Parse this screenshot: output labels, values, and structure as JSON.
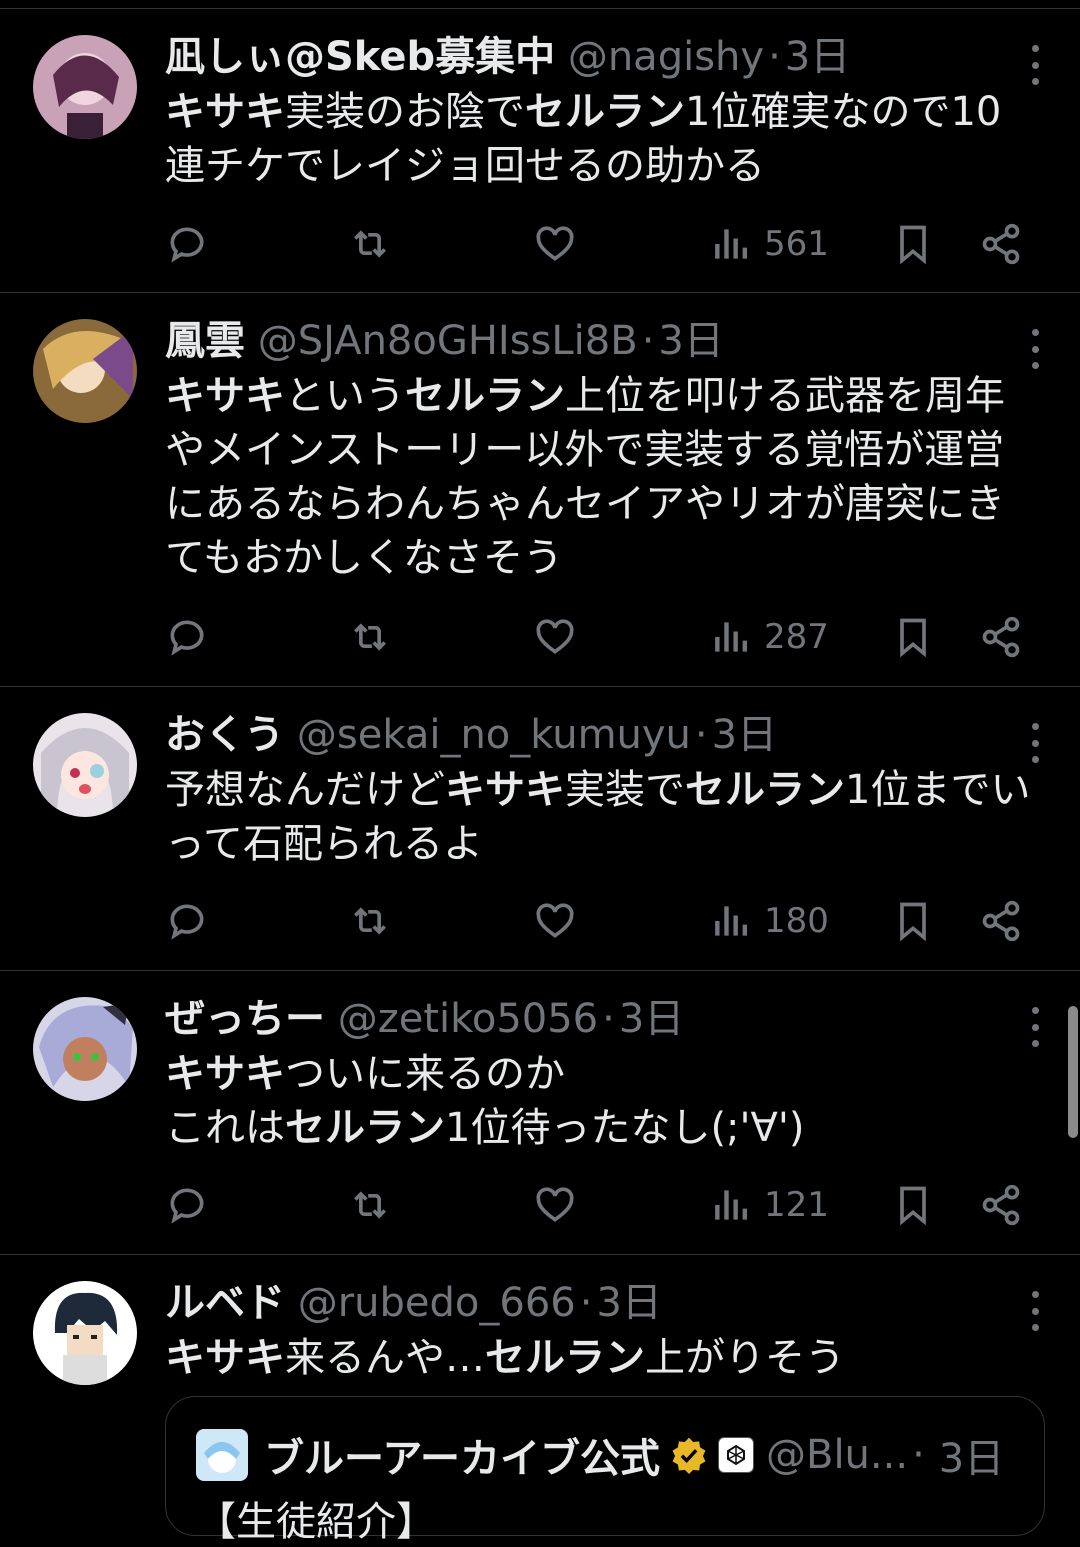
{
  "tweets": [
    {
      "name": "凪しぃ@Skeb募集中",
      "handle": "@nagishy",
      "time": "3日",
      "text_parts": [
        {
          "t": "キサキ",
          "b": true
        },
        {
          "t": "実装のお陰で",
          "b": false
        },
        {
          "t": "セルラン",
          "b": true
        },
        {
          "t": "1位確実なので10連チケでレイジョ回せるの助かる",
          "b": false
        }
      ],
      "views": "561"
    },
    {
      "name": "鳳雲",
      "handle": "@SJAn8oGHIssLi8B",
      "time": "3日",
      "text_parts": [
        {
          "t": "キサキ",
          "b": true
        },
        {
          "t": "という",
          "b": false
        },
        {
          "t": "セルラン",
          "b": true
        },
        {
          "t": "上位を叩ける武器を周年やメインストーリー以外で実装する覚悟が運営にあるならわんちゃんセイアやリオが唐突にきてもおかしくなさそう",
          "b": false
        }
      ],
      "views": "287"
    },
    {
      "name": "おくう",
      "handle": "@sekai_no_kumuyu",
      "time": "3日",
      "text_parts": [
        {
          "t": "予想なんだけど",
          "b": false
        },
        {
          "t": "キサキ",
          "b": true
        },
        {
          "t": "実装で",
          "b": false
        },
        {
          "t": "セルラン",
          "b": true
        },
        {
          "t": "1位までいって石配られるよ",
          "b": false
        }
      ],
      "views": "180"
    },
    {
      "name": "ぜっちー",
      "handle": "@zetiko5056",
      "time": "3日",
      "text_parts": [
        {
          "t": "キサキ",
          "b": true
        },
        {
          "t": "ついに来るのか\nこれは",
          "b": false
        },
        {
          "t": "セルラン",
          "b": true
        },
        {
          "t": "1位待ったなし(;'∀')",
          "b": false
        }
      ],
      "views": "121"
    },
    {
      "name": "ルベド",
      "handle": "@rubedo_666",
      "time": "3日",
      "text_parts": [
        {
          "t": "キサキ",
          "b": true
        },
        {
          "t": "来るんや…",
          "b": false
        },
        {
          "t": "セルラン",
          "b": true
        },
        {
          "t": "上がりそう",
          "b": false
        }
      ],
      "views": ""
    }
  ],
  "quote": {
    "name": "ブルーアーカイブ公式",
    "handle": "@Blu...",
    "time": "3日",
    "text": "【生徒紹介】"
  },
  "separator": "·",
  "icons": [
    "reply-icon",
    "retweet-icon",
    "like-icon",
    "views-icon",
    "bookmark-icon",
    "share-icon",
    "more-icon",
    "verified-badge-icon"
  ],
  "colors": {
    "background": "#000000",
    "text": "#e7e9ea",
    "muted": "#71767b",
    "border": "#2f3336",
    "gold": "#e8b829"
  }
}
